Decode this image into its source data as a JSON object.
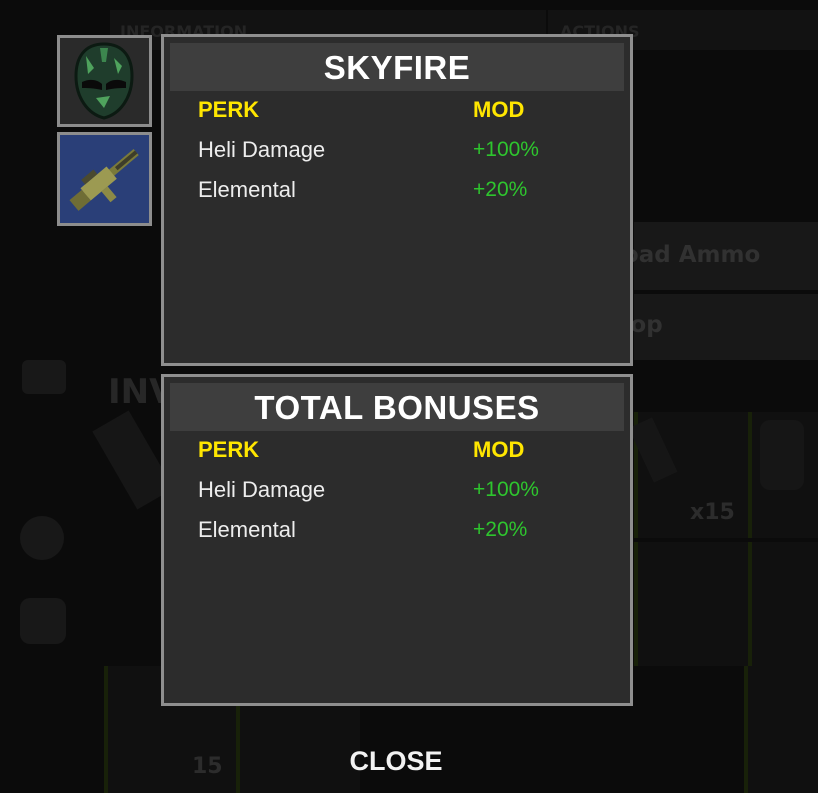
{
  "background": {
    "information_tab": "INFORMATION",
    "actions_tab": "ACTIONS",
    "unload_ammo_label": "Unload Ammo",
    "drop_label": "Drop",
    "inventory_label": "INV",
    "stack_count_a": "x15",
    "stack_count_b": "15"
  },
  "items": [
    {
      "name": "mask",
      "icon": "metal-facemask-icon"
    },
    {
      "name": "weapon",
      "icon": "m249-rifle-icon"
    }
  ],
  "set_panel": {
    "title": "SKYFIRE",
    "perk_header": "PERK",
    "mod_header": "MOD",
    "rows": [
      {
        "perk": "Heli Damage",
        "mod": "+100%"
      },
      {
        "perk": "Elemental",
        "mod": "+20%"
      }
    ]
  },
  "total_panel": {
    "title": "TOTAL BONUSES",
    "perk_header": "PERK",
    "mod_header": "MOD",
    "rows": [
      {
        "perk": "Heli Damage",
        "mod": "+100%"
      },
      {
        "perk": "Elemental",
        "mod": "+20%"
      }
    ]
  },
  "close_label": "CLOSE",
  "colors": {
    "perk_header": "#ffe600",
    "mod_value": "#2ec52e",
    "panel_bg": "#2c2c2c",
    "panel_border": "#8f8f8f"
  }
}
